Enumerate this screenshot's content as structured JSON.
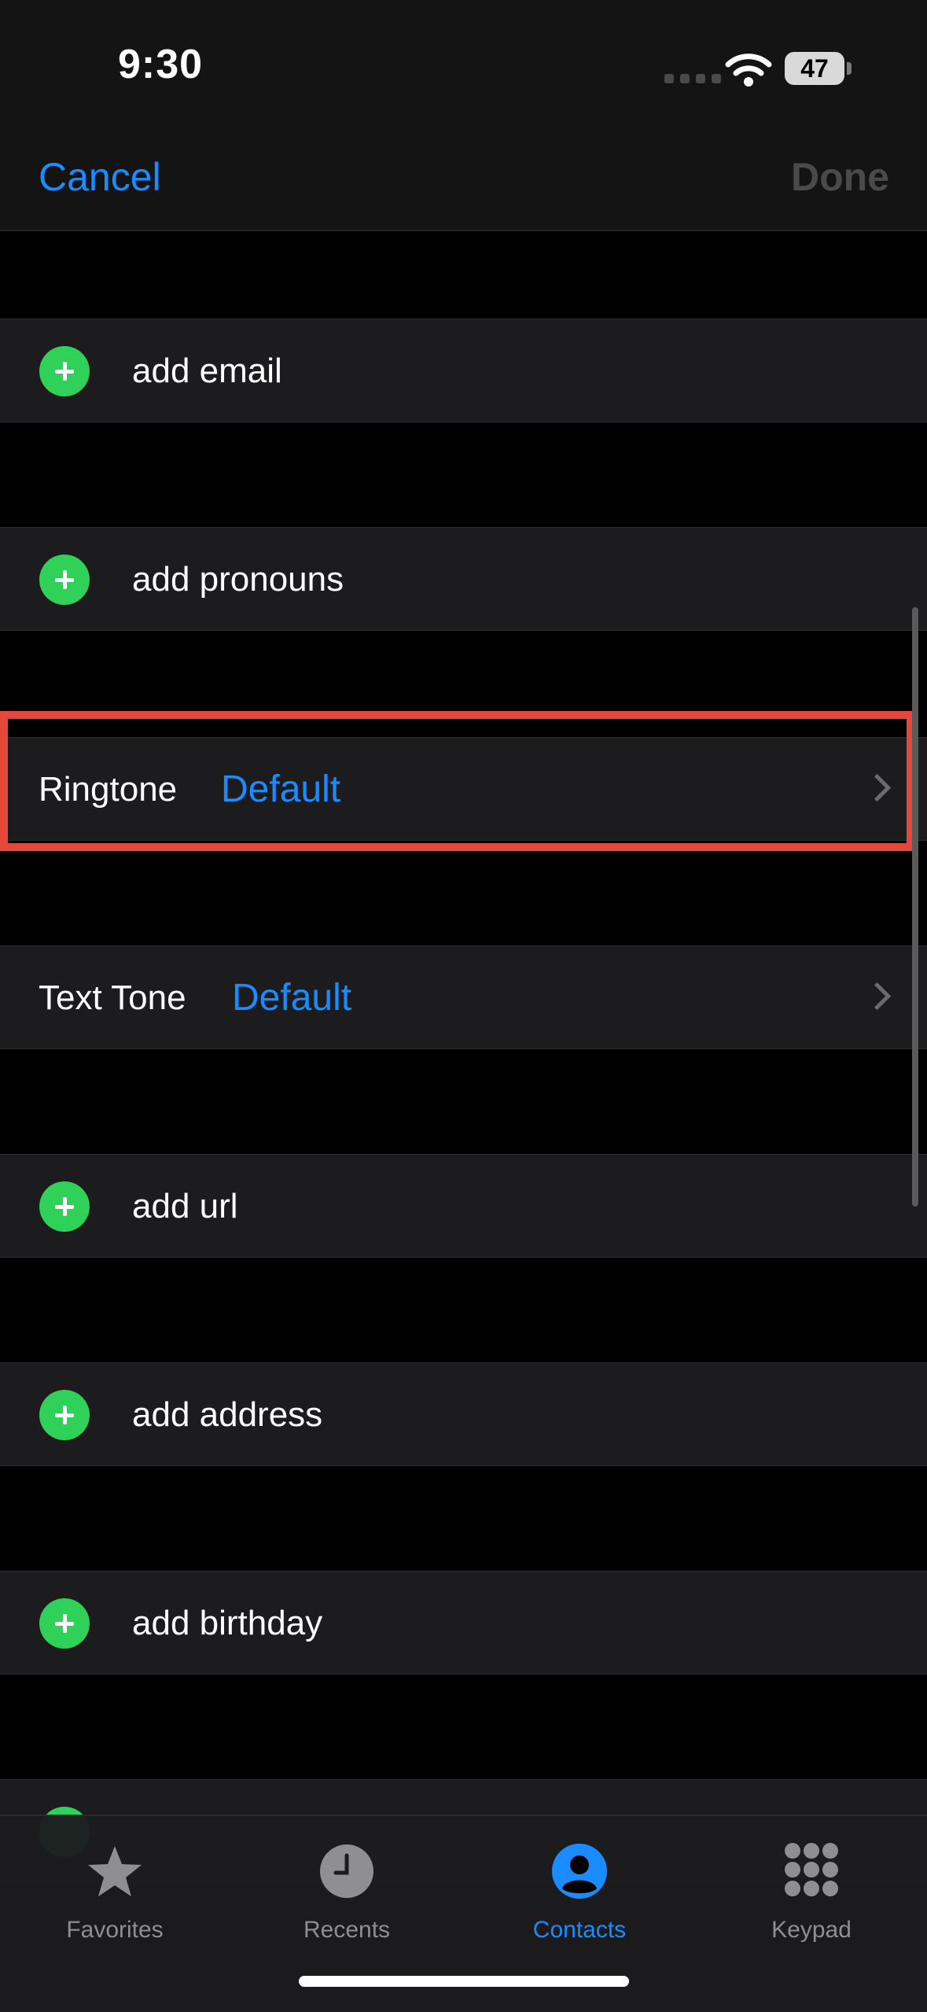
{
  "status_bar": {
    "time": "9:30",
    "battery": "47"
  },
  "nav": {
    "cancel": "Cancel",
    "done": "Done"
  },
  "rows": {
    "add_email": "add email",
    "add_pronouns": "add pronouns",
    "ringtone": {
      "label": "Ringtone",
      "value": "Default"
    },
    "text_tone": {
      "label": "Text Tone",
      "value": "Default"
    },
    "add_url": "add url",
    "add_address": "add address",
    "add_birthday": "add birthday"
  },
  "tabs": [
    {
      "label": "Favorites",
      "icon": "star-icon",
      "active": false
    },
    {
      "label": "Recents",
      "icon": "clock-icon",
      "active": false
    },
    {
      "label": "Contacts",
      "icon": "person-circle-icon",
      "active": true
    },
    {
      "label": "Keypad",
      "icon": "keypad-icon",
      "active": false
    }
  ],
  "colors": {
    "accent": "#1a8cff",
    "add": "#30d158",
    "highlight": "#e5473b"
  }
}
